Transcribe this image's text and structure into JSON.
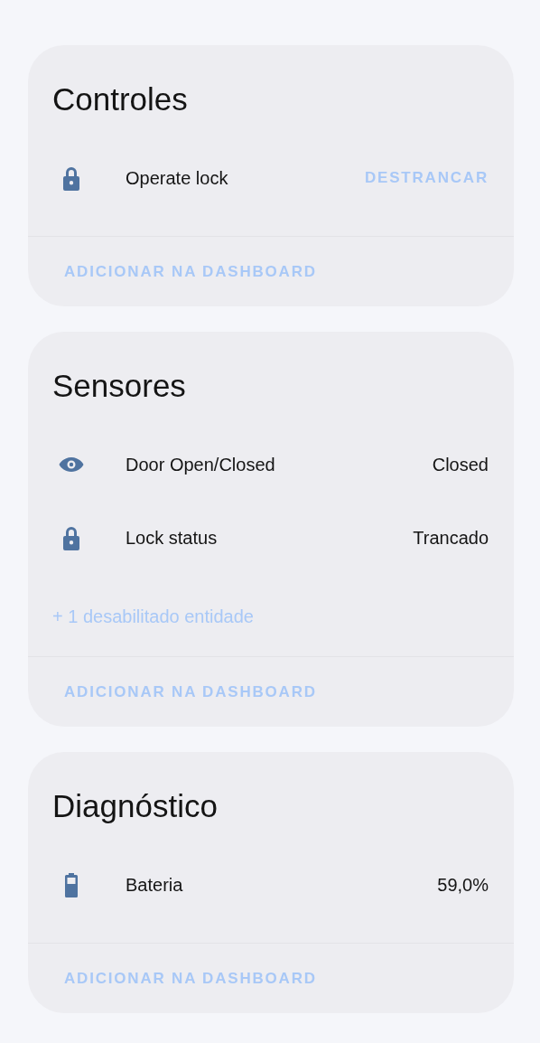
{
  "cards": [
    {
      "title": "Controles",
      "entities": [
        {
          "kind": "lock",
          "label": "Operate lock",
          "action": "DESTRANCAR"
        }
      ],
      "footer": "ADICIONAR NA DASHBOARD"
    },
    {
      "title": "Sensores",
      "entities": [
        {
          "kind": "eye",
          "label": "Door Open/Closed",
          "value": "Closed"
        },
        {
          "kind": "lock",
          "label": "Lock status",
          "value": "Trancado"
        }
      ],
      "disabled_note": "+ 1 desabilitado entidade",
      "footer": "ADICIONAR NA DASHBOARD"
    },
    {
      "title": "Diagnóstico",
      "entities": [
        {
          "kind": "battery",
          "label": "Bateria",
          "value": "59,0%"
        }
      ],
      "footer": "ADICIONAR NA DASHBOARD"
    }
  ]
}
